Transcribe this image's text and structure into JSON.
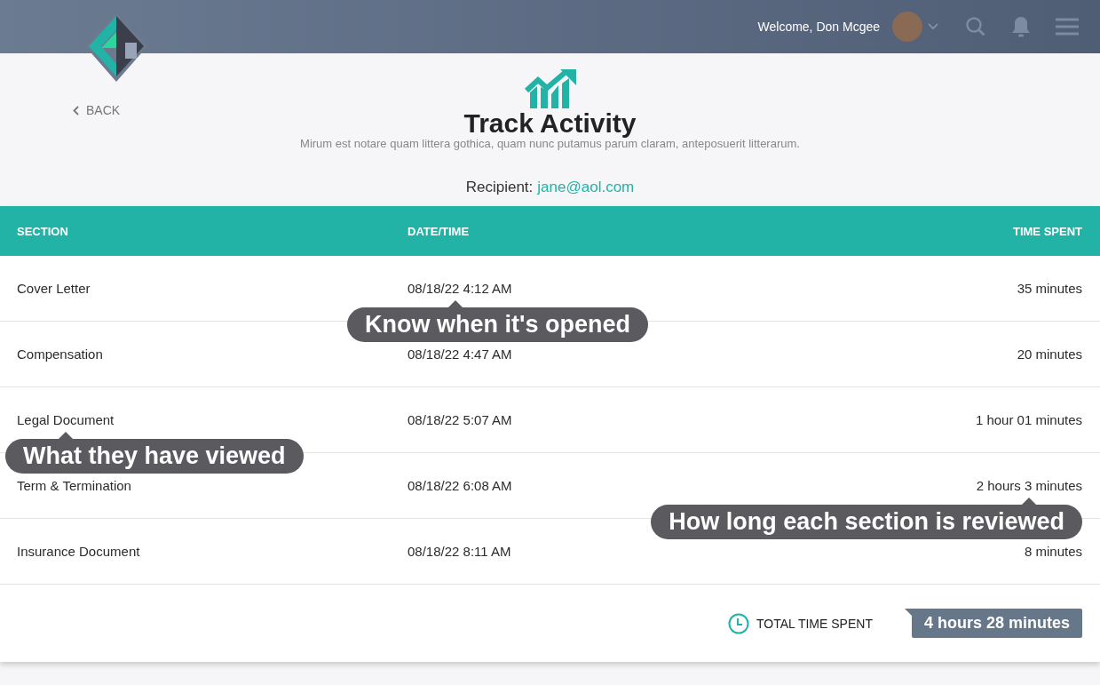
{
  "header": {
    "welcome": "Welcome, Don Mcgee"
  },
  "back": {
    "label": "BACK"
  },
  "page": {
    "title": "Track Activity",
    "subtitle": "Mirum est notare quam littera gothica, quam nunc putamus parum claram, anteposuerit litterarum.",
    "recipient_label": "Recipient:",
    "recipient": "jane@aol.com"
  },
  "table": {
    "columns": [
      "SECTION",
      "DATE/TIME",
      "TIME SPENT"
    ],
    "rows": [
      {
        "section": "Cover Letter",
        "datetime": "08/18/22 4:12 AM",
        "time_spent": "35 minutes"
      },
      {
        "section": "Compensation",
        "datetime": "08/18/22 4:47 AM",
        "time_spent": "20 minutes"
      },
      {
        "section": "Legal Document",
        "datetime": "08/18/22 5:07 AM",
        "time_spent": "1 hour 01 minutes"
      },
      {
        "section": "Term & Termination",
        "datetime": "08/18/22 6:08 AM",
        "time_spent": "2 hours 3 minutes"
      },
      {
        "section": "Insurance Document",
        "datetime": "08/18/22 8:11 AM",
        "time_spent": "8 minutes"
      }
    ]
  },
  "callouts": [
    {
      "text": "Know when it's opened",
      "kind": "date"
    },
    {
      "text": "What they have viewed",
      "kind": "start"
    },
    {
      "text": "How long each section is reviewed",
      "kind": "end"
    }
  ],
  "total": {
    "label": "TOTAL TIME SPENT",
    "value": "4 hours 28 minutes"
  }
}
